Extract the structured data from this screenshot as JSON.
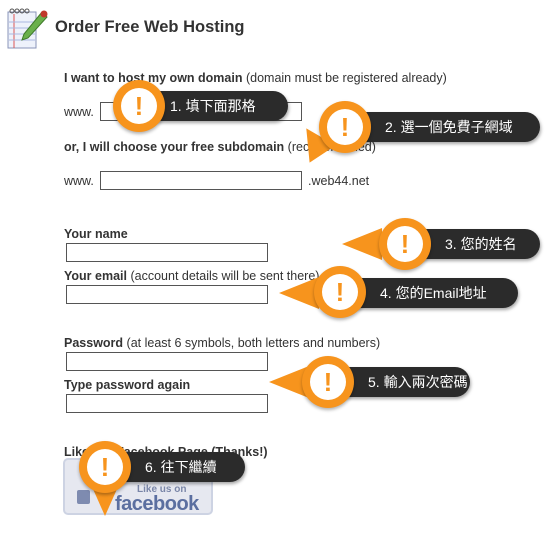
{
  "header": {
    "title": "Order Free Web Hosting",
    "icon": "notepad-pencil-icon"
  },
  "form": {
    "own_domain_bold": "I want to host my own domain",
    "own_domain_note": "(domain must be registered already)",
    "www_prefix": "www.",
    "subdomain_bold": "or, I will choose your free subdomain",
    "subdomain_note": "(recommended)",
    "subdomain_suffix": ".web44.net",
    "name_label": "Your name",
    "email_bold": "Your email",
    "email_note": "(account details will be sent there)",
    "password_bold": "Password",
    "password_note": "(at least 6 symbols, both letters and numbers)",
    "password_again_label": "Type password again",
    "facebook_label": "Like our Facebook Page (Thanks!)",
    "facebook_small": "Like us on",
    "facebook_logo": "facebook"
  },
  "callouts": [
    {
      "mark": "!",
      "text": "1. 填下面那格"
    },
    {
      "mark": "!",
      "text": "2. 選一個免費子網域"
    },
    {
      "mark": "!",
      "text": "3. 您的姓名"
    },
    {
      "mark": "!",
      "text": "4. 您的Email地址"
    },
    {
      "mark": "!",
      "text": "5. 輸入兩次密碼"
    },
    {
      "mark": "!",
      "text": "6. 往下繼續"
    }
  ],
  "colors": {
    "accent": "#f7941d",
    "callout_bg": "#2b2b2b"
  }
}
